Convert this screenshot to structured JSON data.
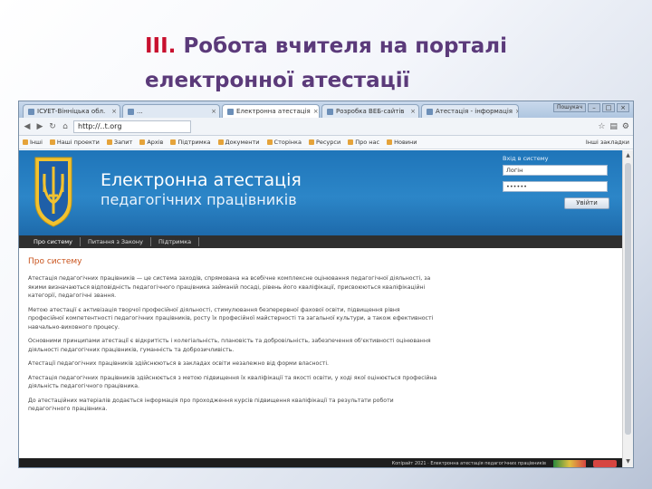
{
  "slide": {
    "title_num": "III.",
    "title_line1": "Робота вчителя на порталі",
    "title_line2": "електронної атестації"
  },
  "browser": {
    "tabs": [
      {
        "label": "ІСУЕТ-Вінніцька обл.",
        "active": false
      },
      {
        "label": "...",
        "active": false
      },
      {
        "label": "Електронна атестація",
        "active": true
      },
      {
        "label": "Розробка ВЕБ-сайтів",
        "active": false
      },
      {
        "label": "Атестація - інформація",
        "active": false
      }
    ],
    "window_label": "Пошукач",
    "url": "http://..t.org",
    "bookmarks": [
      "Інші",
      "Наші проекти",
      "Запит",
      "Архів",
      "Підтримка",
      "Документи",
      "Сторінка",
      "Ресурси",
      "Про нас",
      "Новини"
    ],
    "bookmarks_right": "Інші закладки"
  },
  "site": {
    "title": "Електронна атестація",
    "subtitle": "педагогічних працівників",
    "login_caption": "Вхід в систему",
    "login_placeholder": "Логін",
    "password_value": "••••••",
    "login_button": "Увійти",
    "nav": [
      "Про систему",
      "Питання з Закону",
      "Підтримка"
    ],
    "content_heading": "Про систему",
    "paragraphs": [
      "Атестація педагогічних працівників — це система заходів, спрямована на всебічне комплексне оцінювання педагогічної діяльності, за якими визначаються відповідність педагогічного працівника займаній посаді, рівень його кваліфікації, присвоюються кваліфікаційні категорії, педагогічні звання.",
      "Метою атестації є активізація творчої професійної діяльності, стимулювання безперервної фахової освіти, підвищення рівня професійної компетентності педагогічних працівників, росту їх професійної майстерності та загальної культури, а також ефективності навчально-виховного процесу.",
      "Основними принципами атестації є відкритість і колегіальність, плановість та добровільність, забезпечення об'єктивності оцінювання діяльності педагогічних працівників, гуманність та доброзичливість.",
      "Атестації педагогічних працівників здійснюються в закладах освіти незалежно від форми власності.",
      "Атестація педагогічних працівників здійснюється з метою підвищення їх кваліфікації та якості освіти, у ході якої оцінюється професійна діяльність педагогічного працівника.",
      "До атестаційних матеріалів додається інформація про проходження курсів підвищення кваліфікації та результати роботи педагогічного працівника."
    ],
    "footer_text": "Копірайт 2021 · Електронна атестація педагогічних працівників"
  },
  "icons": {
    "tab_favicon": "page-icon",
    "tab_close": "close-icon",
    "nav_back": "back-arrow-icon",
    "nav_forward": "forward-arrow-icon",
    "reload": "reload-icon",
    "home": "home-icon",
    "star": "star-icon",
    "wrench": "wrench-icon",
    "coat_of_arms": "trident-coat-of-arms-icon"
  },
  "colors": {
    "slide_title": "#5b3a7a",
    "slide_number": "#c8102e",
    "header_blue": "#1f75b9",
    "nav_bar": "#2f2f2f",
    "content_heading": "#c9541d",
    "coat_gold": "#f2c230"
  }
}
